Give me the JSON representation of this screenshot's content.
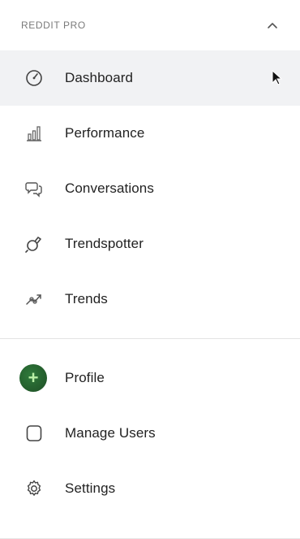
{
  "section": {
    "title": "REDDIT PRO",
    "collapse_icon": "chevron-up-icon"
  },
  "nav": {
    "items": [
      {
        "label": "Dashboard",
        "icon": "gauge-icon",
        "active": true
      },
      {
        "label": "Performance",
        "icon": "bar-chart-icon",
        "active": false
      },
      {
        "label": "Conversations",
        "icon": "chat-bubbles-icon",
        "active": false
      },
      {
        "label": "Trendspotter",
        "icon": "trendspotter-icon",
        "active": false
      },
      {
        "label": "Trends",
        "icon": "trend-link-icon",
        "active": false
      }
    ]
  },
  "account": {
    "items": [
      {
        "label": "Profile",
        "icon": "avatar"
      },
      {
        "label": "Manage Users",
        "icon": "square-outline-icon"
      },
      {
        "label": "Settings",
        "icon": "gear-icon"
      }
    ]
  },
  "colors": {
    "active_bg": "#f1f2f4",
    "avatar": "#2f7a3b",
    "text": "#222222",
    "muted": "#7a7a7a"
  }
}
